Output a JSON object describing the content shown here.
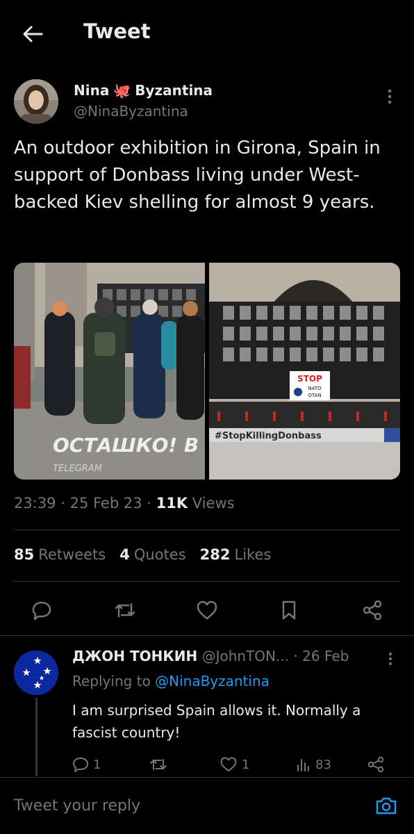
{
  "header": {
    "title": "Tweet"
  },
  "tweet": {
    "author_name_first": "Nina",
    "author_name_last": "Byzantina",
    "author_emoji": "🐙",
    "handle": "@NinaByzantina",
    "text": "An outdoor exhibition in Girona, Spain in support of Donbass living under West-backed Kiev shelling for almost 9 years.",
    "media": {
      "left_caption": "ОСТАШКО! В",
      "left_watermark": "TELEGRAM",
      "right_banner": "#StopKillingDonbass",
      "right_sign_top": "STOP",
      "right_sign_mid": "NATO",
      "right_sign_bottom": "OTAN"
    },
    "time": "23:39",
    "date": "25 Feb 23",
    "views_count": "11K",
    "views_label": "Views",
    "retweets_count": "85",
    "retweets_label": "Retweets",
    "quotes_count": "4",
    "quotes_label": "Quotes",
    "likes_count": "282",
    "likes_label": "Likes"
  },
  "reply": {
    "name": "ДЖОН ТОНКИН",
    "handle": "@JohnTON...",
    "date": "· 26 Feb",
    "replying_prefix": "Replying to",
    "replying_to": "@NinaByzantina",
    "text": "I am surprised Spain allows it. Normally a fascist country!",
    "reply_count": "1",
    "like_count": "1",
    "views_count": "83"
  },
  "composer": {
    "placeholder": "Tweet your reply"
  },
  "colors": {
    "background": "#000000",
    "text": "#e7e9ea",
    "muted": "#71767b",
    "accent": "#1d9bf0",
    "divider": "#2f3336"
  },
  "icons": [
    "back-arrow-icon",
    "more-vertical-icon",
    "reply-icon",
    "retweet-icon",
    "like-icon",
    "bookmark-icon",
    "share-icon",
    "views-icon",
    "camera-icon"
  ]
}
